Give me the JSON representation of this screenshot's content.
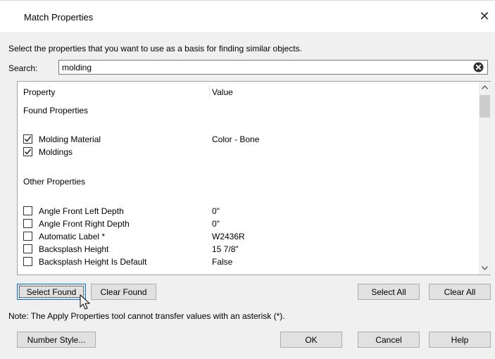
{
  "window": {
    "title": "Match Properties",
    "close_symbol": "✕"
  },
  "instruction": "Select the properties that you want to use as a basis for finding similar objects.",
  "search": {
    "label": "Search:",
    "value": "molding",
    "clear_icon": "clear-circle-icon"
  },
  "list": {
    "columns": {
      "property": "Property",
      "value": "Value"
    },
    "found_header": "Found Properties",
    "found": [
      {
        "label": "Molding Material",
        "value": "Color - Bone",
        "checked": true
      },
      {
        "label": "Moldings",
        "value": "",
        "checked": true
      }
    ],
    "other_header": "Other Properties",
    "other": [
      {
        "label": "Angle Front Left Depth",
        "value": "0\"",
        "checked": false
      },
      {
        "label": "Angle Front Right Depth",
        "value": "0\"",
        "checked": false
      },
      {
        "label": "Automatic Label *",
        "value": "W2436R",
        "checked": false
      },
      {
        "label": "Backsplash Height",
        "value": "15 7/8\"",
        "checked": false
      },
      {
        "label": "Backsplash Height Is Default",
        "value": "False",
        "checked": false
      }
    ]
  },
  "buttons": {
    "select_found": "Select Found",
    "clear_found": "Clear Found",
    "select_all": "Select All",
    "clear_all": "Clear All",
    "number_style": "Number Style...",
    "ok": "OK",
    "cancel": "Cancel",
    "help": "Help"
  },
  "note": "Note: The Apply Properties tool cannot transfer values with an asterisk (*).",
  "colors": {
    "dialog_bg": "#f0f0f0",
    "button_bg": "#e1e1e1",
    "focus_border": "#0078d7"
  }
}
